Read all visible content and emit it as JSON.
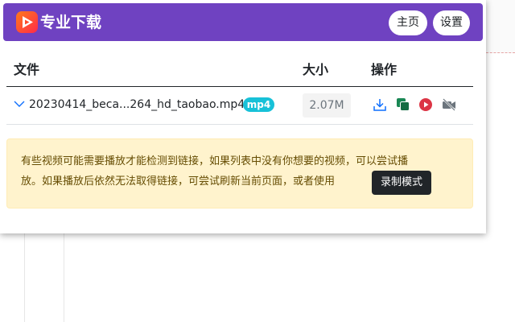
{
  "header": {
    "title": "专业下载",
    "home_label": "主页",
    "settings_label": "设置",
    "color": "#6f42c1",
    "logo_icon": "play-logo-icon"
  },
  "table": {
    "columns": [
      "文件",
      "大小",
      "操作"
    ],
    "rows": [
      {
        "filename": "20230414_beca...264_hd_taobao.mp4",
        "format": "mp4",
        "size": "2.07M",
        "actions": [
          "download-icon",
          "copy-icon",
          "play-icon",
          "video-off-icon"
        ]
      }
    ]
  },
  "notice": {
    "line1": "有些视频可能需要播放才能检测到链接，如果列表中没有你想要的视频，可以尝试播",
    "line2": "放。如果播放后依然无法取得链接，可尝试刷新当前页面，或者使用",
    "record_button": "录制模式"
  },
  "colors": {
    "badge": "#17c1d8",
    "download": "#0d6efd",
    "copy": "#198754",
    "play": "#dc3545",
    "video_off": "#6c757d",
    "notice_bg": "#fff3cd"
  }
}
